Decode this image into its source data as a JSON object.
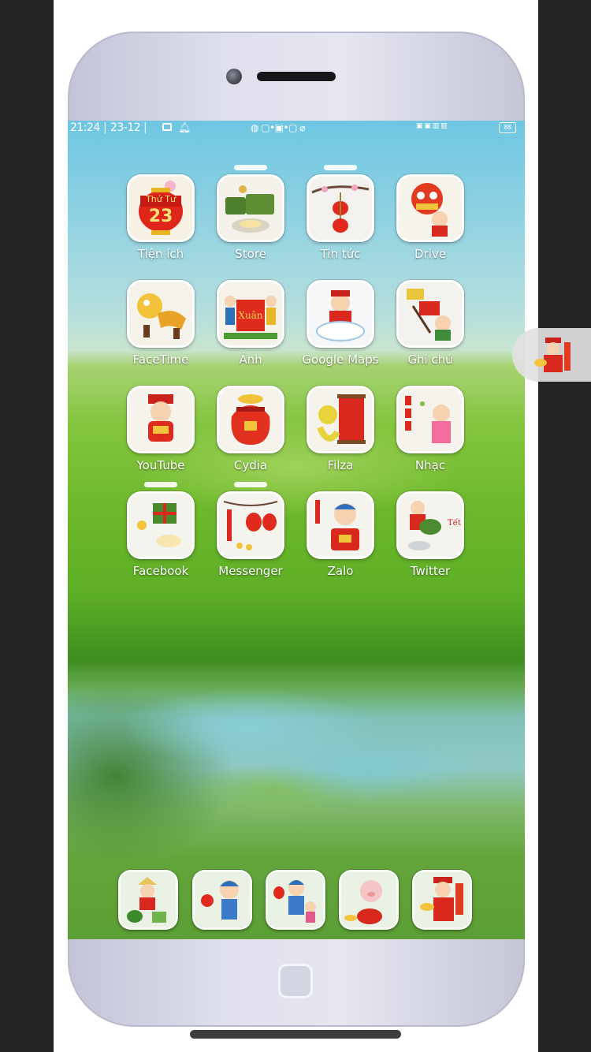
{
  "status_bar": {
    "time": "21:24",
    "separator": "|",
    "date": "23-12",
    "middle_icons": "◍ ▢•▣•▢ ⌀",
    "right_icons": "▣ ▣ ▥ ▥",
    "battery": "88"
  },
  "apps": [
    {
      "label": "Tiện ích",
      "icon": "lantern-calendar-icon",
      "calendar_day": "Thứ Tư",
      "calendar_date": "23"
    },
    {
      "label": "Store",
      "icon": "rice-cake-icon"
    },
    {
      "label": "Tin tức",
      "icon": "blossom-lantern-icon"
    },
    {
      "label": "Drive",
      "icon": "lion-dance-icon"
    },
    {
      "label": "FaceTime",
      "icon": "dragon-dance-icon"
    },
    {
      "label": "Ảnh",
      "icon": "couple-banner-icon"
    },
    {
      "label": "Google Maps",
      "icon": "god-of-wealth-cloud-icon"
    },
    {
      "label": "Ghi chú",
      "icon": "calligraphy-icon"
    },
    {
      "label": "YouTube",
      "icon": "god-of-wealth-icon"
    },
    {
      "label": "Cydia",
      "icon": "lucky-bag-icon"
    },
    {
      "label": "Filza",
      "icon": "snake-scroll-icon"
    },
    {
      "label": "Nhạc",
      "icon": "girl-firecracker-icon"
    },
    {
      "label": "Facebook",
      "icon": "gift-box-icon"
    },
    {
      "label": "Messenger",
      "icon": "lanterns-icon"
    },
    {
      "label": "Zalo",
      "icon": "boy-envelope-icon"
    },
    {
      "label": "Twitter",
      "icon": "cooking-boy-icon"
    }
  ],
  "dock": [
    {
      "icon": "watermelon-girl-icon"
    },
    {
      "icon": "boy-flowers-icon"
    },
    {
      "icon": "children-lantern-icon"
    },
    {
      "icon": "pig-gold-icon"
    },
    {
      "icon": "wealth-god-gold-icon"
    }
  ],
  "floating_button": {
    "icon": "wealth-god-assistive-icon"
  }
}
